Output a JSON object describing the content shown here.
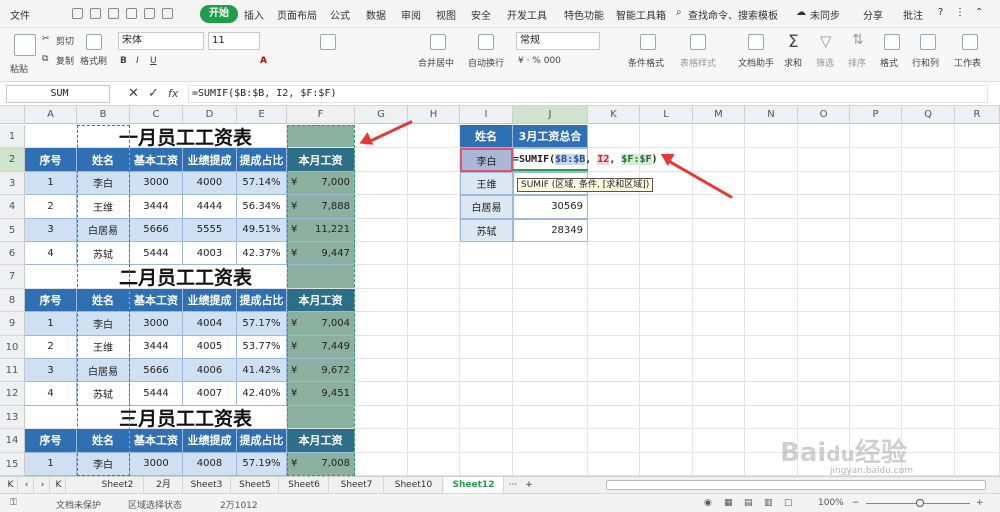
{
  "menubar": {
    "file": "文件",
    "start": "开始",
    "tabs": [
      "插入",
      "页面布局",
      "公式",
      "数据",
      "审阅",
      "视图",
      "安全",
      "开发工具",
      "特色功能",
      "智能工具箱"
    ],
    "search": "查找命令、搜索模板",
    "sync": "未同步",
    "share": "分享",
    "batch": "批注"
  },
  "ribbon": {
    "cut": "剪切",
    "copy": "复制",
    "paste": "粘贴",
    "format_painter": "格式刷",
    "font_name": "宋体",
    "font_size": "11",
    "merge_center": "合并居中",
    "wrap": "自动换行",
    "number_format": "常规",
    "cond_format": "条件格式",
    "table_style": "表格样式",
    "doc_helper": "文档助手",
    "sum": "求和",
    "filter": "筛选",
    "sort": "排序",
    "format": "格式",
    "rowcol": "行和列",
    "worksheet": "工作表"
  },
  "formula_bar": {
    "name_box": "SUM",
    "fx": "fx",
    "formula": "=SUMIF($B:$B, I2, $F:$F)"
  },
  "columns": [
    "A",
    "B",
    "C",
    "D",
    "E",
    "F",
    "G",
    "H",
    "I",
    "J",
    "K",
    "L",
    "M",
    "N",
    "O",
    "P",
    "Q",
    "R"
  ],
  "rows": [
    "1",
    "2",
    "3",
    "4",
    "5",
    "6",
    "7",
    "8",
    "9",
    "10",
    "11",
    "12",
    "13",
    "14",
    "15"
  ],
  "tables": [
    {
      "title": "一月员工工资表",
      "headers": [
        "序号",
        "姓名",
        "基本工资",
        "业绩提成",
        "提成占比",
        "本月工资"
      ],
      "rows": [
        [
          "1",
          "李白",
          "3000",
          "4000",
          "57.14%",
          "7,000"
        ],
        [
          "2",
          "王维",
          "3444",
          "4444",
          "56.34%",
          "7,888"
        ],
        [
          "3",
          "白居易",
          "5666",
          "5555",
          "49.51%",
          "11,221"
        ],
        [
          "4",
          "苏轼",
          "5444",
          "4003",
          "42.37%",
          "9,447"
        ]
      ]
    },
    {
      "title": "二月员工工资表",
      "headers": [
        "序号",
        "姓名",
        "基本工资",
        "业绩提成",
        "提成占比",
        "本月工资"
      ],
      "rows": [
        [
          "1",
          "李白",
          "3000",
          "4004",
          "57.17%",
          "7,004"
        ],
        [
          "2",
          "王维",
          "3444",
          "4005",
          "53.77%",
          "7,449"
        ],
        [
          "3",
          "白居易",
          "5666",
          "4006",
          "41.42%",
          "9,672"
        ],
        [
          "4",
          "苏轼",
          "5444",
          "4007",
          "42.40%",
          "9,451"
        ]
      ]
    },
    {
      "title": "三月员工工资表",
      "headers": [
        "序号",
        "姓名",
        "基本工资",
        "业绩提成",
        "提成占比",
        "本月工资"
      ],
      "rows": [
        [
          "1",
          "李白",
          "3000",
          "4008",
          "57.19%",
          "7,008"
        ]
      ]
    }
  ],
  "currency": "¥",
  "summary": {
    "headers": [
      "姓名",
      "3月工资总合"
    ],
    "rows": [
      [
        "李白",
        ""
      ],
      [
        "王维",
        ""
      ],
      [
        "白居易",
        "30569"
      ],
      [
        "苏轼",
        "28349"
      ]
    ]
  },
  "editing": {
    "prefix": "=SUMIF(",
    "arg1": "$B:$B",
    "sep1": ", ",
    "arg2": "I2",
    "sep2": ", ",
    "arg3": "$F:$F",
    "suffix": ")",
    "tooltip": "SUMIF (区域, 条件, [求和区域])"
  },
  "sheet_tabs": [
    "Sheet2",
    "2月",
    "Sheet3",
    "Sheet5",
    "Sheet6",
    "Sheet7",
    "Sheet10",
    "Sheet12"
  ],
  "active_sheet": "Sheet12",
  "more_tabs": "···",
  "add_tab": "+",
  "status": {
    "protect": "文档未保护",
    "mode": "区域选择状态",
    "count": "2万1012",
    "zoom": "100%"
  },
  "watermark": "Baidu经验 jingyan.baidu.com"
}
